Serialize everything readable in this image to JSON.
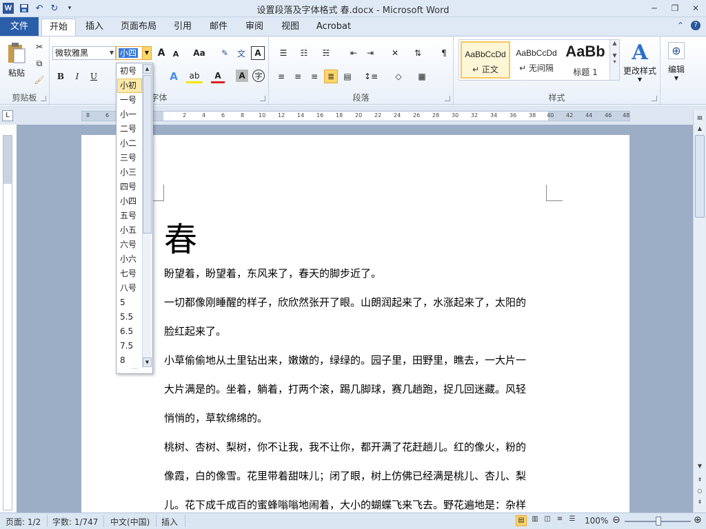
{
  "title_bar": {
    "app_icon": "W",
    "title": "设置段落及字体格式 春.docx  -  Microsoft Word",
    "qat": [
      "save-icon",
      "undo-icon",
      "redo-icon",
      "customize-icon"
    ]
  },
  "tabs": {
    "file": "文件",
    "items": [
      "开始",
      "插入",
      "页面布局",
      "引用",
      "邮件",
      "审阅",
      "视图",
      "Acrobat"
    ],
    "active": "开始"
  },
  "ribbon": {
    "clipboard": {
      "paste": "粘贴",
      "label": "剪贴板"
    },
    "font": {
      "family": "微软雅黑",
      "size": "小四",
      "label": "字体",
      "bold": "B",
      "italic": "I",
      "underline": "U",
      "grow": "A",
      "shrink": "A",
      "case": "Aa",
      "color_letter": "A"
    },
    "paragraph": {
      "label": "段落"
    },
    "styles": {
      "label": "样式",
      "items": [
        {
          "sample": "AaBbCcDd",
          "name": "↵ 正文"
        },
        {
          "sample": "AaBbCcDd",
          "name": "↵ 无间隔"
        },
        {
          "sample": "AaBb",
          "name": "标题 1"
        }
      ],
      "change_styles": "更改样式"
    },
    "editing": {
      "label": "编辑"
    }
  },
  "font_size_dropdown": {
    "items": [
      "初号",
      "小初",
      "一号",
      "小一",
      "二号",
      "小二",
      "三号",
      "小三",
      "四号",
      "小四",
      "五号",
      "小五",
      "六号",
      "小六",
      "七号",
      "八号",
      "5",
      "5.5",
      "6.5",
      "7.5",
      "8"
    ],
    "highlighted": "小初"
  },
  "ruler": {
    "numbers": [
      "8",
      "6",
      "4",
      "2",
      "2",
      "4",
      "6",
      "8",
      "10",
      "12",
      "14",
      "16",
      "18",
      "20",
      "22",
      "24",
      "26",
      "28",
      "30",
      "32",
      "34",
      "36",
      "38",
      "40",
      "42",
      "44",
      "46",
      "48"
    ]
  },
  "document": {
    "title": "春",
    "paragraphs": [
      "盼望着，盼望着，东风来了，春天的脚步近了。",
      "一切都像刚睡醒的样子，欣欣然张开了眼。山朗润起来了，水涨起来了，太阳的",
      "脸红起来了。",
      "小草偷偷地从土里钻出来，嫩嫩的，绿绿的。园子里，田野里，瞧去，一大片一",
      "大片满是的。坐着，躺着，打两个滚，踢几脚球，赛几趟跑，捉几回迷藏。风轻",
      "悄悄的，草软绵绵的。",
      "桃树、杏树、梨树，你不让我，我不让你，都开满了花赶趟儿。红的像火，粉的",
      "像霞，白的像雪。花里带着甜味儿；闭了眼，树上仿佛已经满是桃儿、杏儿、梨",
      "儿。花下成千成百的蜜蜂嗡嗡地闹着，大小的蝴蝶飞来飞去。野花遍地是：杂样"
    ]
  },
  "status_bar": {
    "page": "页面: 1/2",
    "words": "字数: 1/747",
    "language": "中文(中国)",
    "mode": "插入",
    "zoom": "100%"
  }
}
